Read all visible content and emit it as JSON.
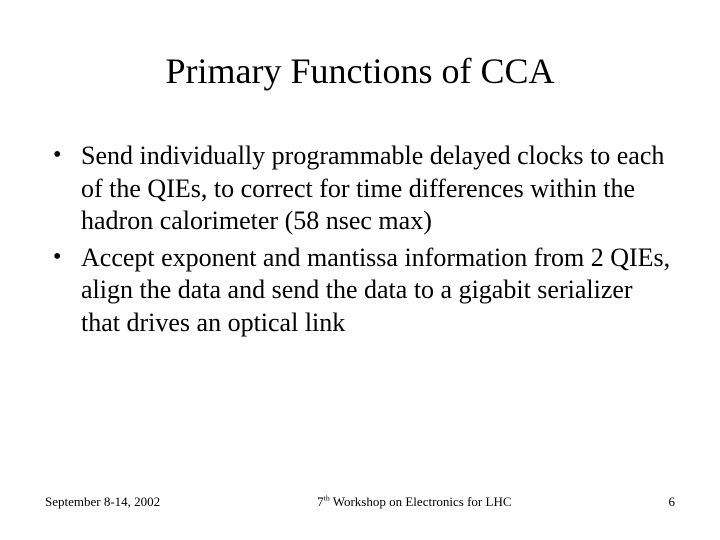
{
  "title": "Primary Functions of CCA",
  "bullets": [
    "Send  individually programmable delayed clocks to each of the QIEs, to correct for time differences within the hadron calorimeter (58 nsec max)",
    "Accept exponent and mantissa information from 2 QIEs, align the data and send the data to a gigabit serializer that drives an optical link"
  ],
  "footer": {
    "date": "September 8-14, 2002",
    "center_pre": "7",
    "center_sup": "th",
    "center_post": " Workshop on Electronics for LHC",
    "page": "6"
  }
}
